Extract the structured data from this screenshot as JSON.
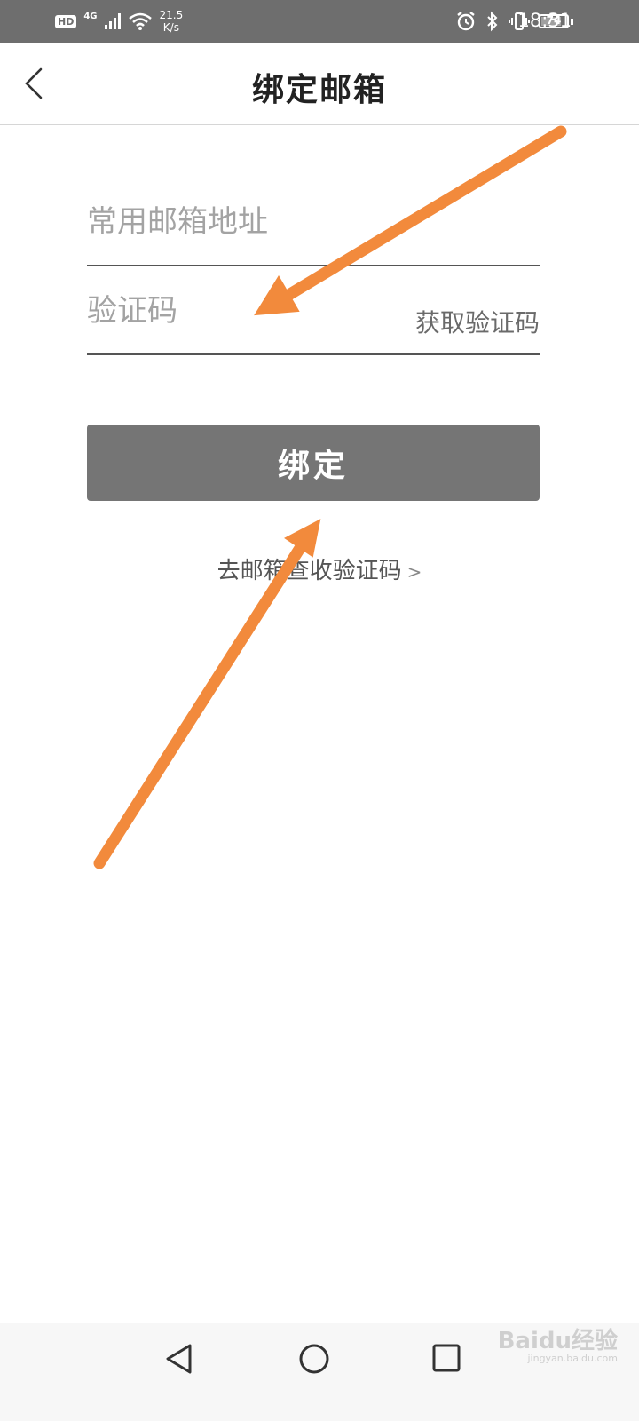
{
  "status_bar": {
    "hd_label": "HD",
    "network_label": "4G",
    "speed_value": "21.5",
    "speed_unit": "K/s",
    "battery_level": "74",
    "time": "18:31"
  },
  "header": {
    "title": "绑定邮箱"
  },
  "form": {
    "email": {
      "value": "",
      "placeholder": "常用邮箱地址"
    },
    "code": {
      "value": "",
      "placeholder": "验证码"
    },
    "get_code_label": "获取验证码",
    "bind_label": "绑定",
    "goto_mailbox_label": "去邮箱查收验证码"
  },
  "watermark": {
    "brand": "Baidu经验",
    "domain": "jingyan.baidu.com"
  },
  "colors": {
    "status_bar": "#6e6e6e",
    "button": "#757575",
    "annotation_arrow": "#f28a3c"
  }
}
